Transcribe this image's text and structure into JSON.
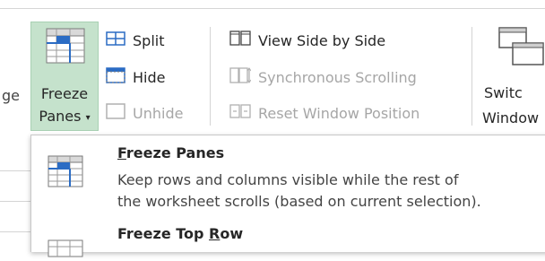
{
  "ribbon": {
    "left_partial_label": "ge",
    "freeze_panes": {
      "line1": "Freeze",
      "line2": "Panes",
      "caret": "▾"
    },
    "split": "Split",
    "hide": "Hide",
    "unhide": "Unhide",
    "view_side_by_side": "View Side by Side",
    "synchronous_scrolling": "Synchronous Scrolling",
    "reset_window_position": "Reset Window Position",
    "switch_windows": {
      "line1": "Switc",
      "line2": "Window"
    }
  },
  "menu": {
    "items": [
      {
        "title_u": "F",
        "title_rest": "reeze Panes",
        "desc_line1": "Keep rows and columns visible while the rest of",
        "desc_line2": "the worksheet scrolls (based on current selection)."
      },
      {
        "title_pre": "Freeze Top ",
        "title_u": "R",
        "title_rest": "ow"
      }
    ]
  },
  "colors": {
    "freeze_highlight": "#c5e2cc",
    "icon_blue": "#2b6cc4",
    "disabled_text": "#a6a6a6"
  }
}
